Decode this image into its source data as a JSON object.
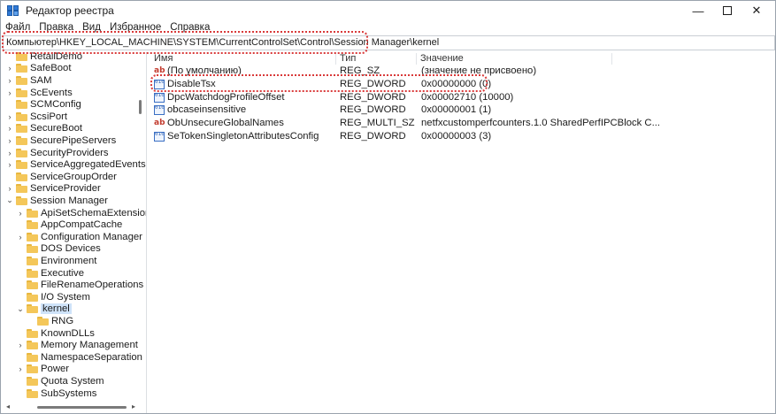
{
  "window": {
    "title": "Редактор реестра"
  },
  "menu": [
    "Файл",
    "Правка",
    "Вид",
    "Избранное",
    "Справка"
  ],
  "address": "Компьютер\\HKEY_LOCAL_MACHINE\\SYSTEM\\CurrentControlSet\\Control\\Session Manager\\kernel",
  "tree": [
    {
      "label": "RetailDemo",
      "level": 0,
      "expander": "",
      "partial": true
    },
    {
      "label": "SafeBoot",
      "level": 0,
      "expander": "›"
    },
    {
      "label": "SAM",
      "level": 0,
      "expander": "›"
    },
    {
      "label": "ScEvents",
      "level": 0,
      "expander": "›"
    },
    {
      "label": "SCMConfig",
      "level": 0,
      "expander": ""
    },
    {
      "label": "ScsiPort",
      "level": 0,
      "expander": "›"
    },
    {
      "label": "SecureBoot",
      "level": 0,
      "expander": "›"
    },
    {
      "label": "SecurePipeServers",
      "level": 0,
      "expander": "›"
    },
    {
      "label": "SecurityProviders",
      "level": 0,
      "expander": "›"
    },
    {
      "label": "ServiceAggregatedEvents",
      "level": 0,
      "expander": "›"
    },
    {
      "label": "ServiceGroupOrder",
      "level": 0,
      "expander": ""
    },
    {
      "label": "ServiceProvider",
      "level": 0,
      "expander": "›"
    },
    {
      "label": "Session Manager",
      "level": 0,
      "expander": "⌄"
    },
    {
      "label": "ApiSetSchemaExtensions",
      "level": 1,
      "expander": "›"
    },
    {
      "label": "AppCompatCache",
      "level": 1,
      "expander": ""
    },
    {
      "label": "Configuration Manager",
      "level": 1,
      "expander": "›"
    },
    {
      "label": "DOS Devices",
      "level": 1,
      "expander": ""
    },
    {
      "label": "Environment",
      "level": 1,
      "expander": ""
    },
    {
      "label": "Executive",
      "level": 1,
      "expander": ""
    },
    {
      "label": "FileRenameOperations",
      "level": 1,
      "expander": ""
    },
    {
      "label": "I/O System",
      "level": 1,
      "expander": ""
    },
    {
      "label": "kernel",
      "level": 1,
      "expander": "⌄",
      "selected": true
    },
    {
      "label": "RNG",
      "level": 2,
      "expander": ""
    },
    {
      "label": "KnownDLLs",
      "level": 1,
      "expander": ""
    },
    {
      "label": "Memory Management",
      "level": 1,
      "expander": "›"
    },
    {
      "label": "NamespaceSeparation",
      "level": 1,
      "expander": ""
    },
    {
      "label": "Power",
      "level": 1,
      "expander": "›"
    },
    {
      "label": "Quota System",
      "level": 1,
      "expander": ""
    },
    {
      "label": "SubSystems",
      "level": 1,
      "expander": ""
    }
  ],
  "columns": {
    "name": "Имя",
    "type": "Тип",
    "value": "Значение"
  },
  "values": [
    {
      "icon": "ab",
      "name": "(По умолчанию)",
      "type": "REG_SZ",
      "data": "(значение не присвоено)"
    },
    {
      "icon": "bin",
      "name": "DisableTsx",
      "type": "REG_DWORD",
      "data": "0x00000000 (0)"
    },
    {
      "icon": "bin",
      "name": "DpcWatchdogProfileOffset",
      "type": "REG_DWORD",
      "data": "0x00002710 (10000)"
    },
    {
      "icon": "bin",
      "name": "obcaseinsensitive",
      "type": "REG_DWORD",
      "data": "0x00000001 (1)"
    },
    {
      "icon": "ab",
      "name": "ObUnsecureGlobalNames",
      "type": "REG_MULTI_SZ",
      "data": "netfxcustomperfcounters.1.0 SharedPerfIPCBlock C..."
    },
    {
      "icon": "bin",
      "name": "SeTokenSingletonAttributesConfig",
      "type": "REG_DWORD",
      "data": "0x00000003 (3)"
    }
  ]
}
